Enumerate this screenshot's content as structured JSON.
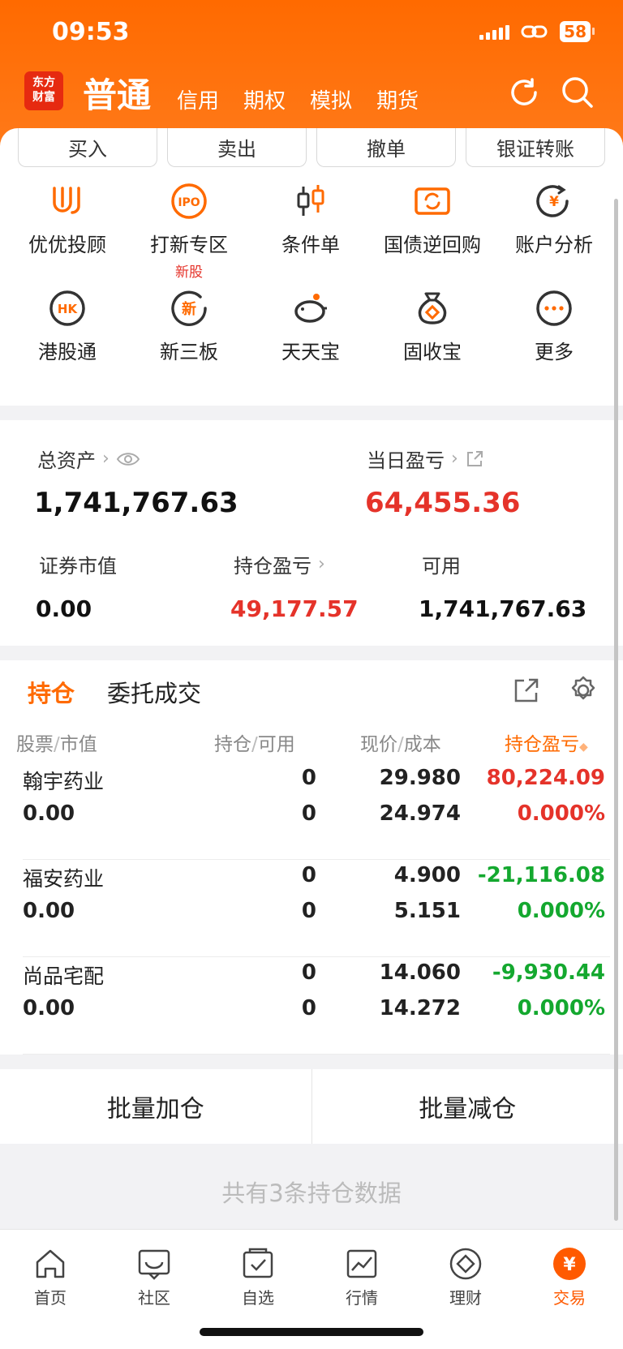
{
  "status": {
    "time": "09:53",
    "battery": "58"
  },
  "header": {
    "logo_line1": "东方",
    "logo_line2": "财富",
    "tabs": [
      "普通",
      "信用",
      "期权",
      "模拟",
      "期货"
    ]
  },
  "quick_buttons": [
    "买入",
    "卖出",
    "撤单",
    "银证转账"
  ],
  "grid": [
    {
      "label": "优优投顾",
      "icon": "uu-advisor-icon"
    },
    {
      "label": "打新专区",
      "sub": "新股",
      "icon": "ipo-icon"
    },
    {
      "label": "条件单",
      "icon": "condition-order-icon"
    },
    {
      "label": "国债逆回购",
      "icon": "bond-repo-icon"
    },
    {
      "label": "账户分析",
      "icon": "account-analysis-icon"
    },
    {
      "label": "港股通",
      "icon": "hk-connect-icon"
    },
    {
      "label": "新三板",
      "icon": "neeq-icon"
    },
    {
      "label": "天天宝",
      "icon": "piggy-bank-icon"
    },
    {
      "label": "固收宝",
      "icon": "money-bag-icon"
    },
    {
      "label": "更多",
      "icon": "more-icon"
    }
  ],
  "assets": {
    "total_label": "总资产",
    "total_value": "1,741,767.63",
    "daily_label": "当日盈亏",
    "daily_value": "64,455.36",
    "market_label": "证券市值",
    "market_value": "0.00",
    "pnl_label": "持仓盈亏",
    "pnl_value": "49,177.57",
    "avail_label": "可用",
    "avail_value": "1,741,767.63"
  },
  "positions": {
    "tabs": [
      "持仓",
      "委托成交"
    ],
    "columns": [
      "股票",
      "市值",
      "持仓",
      "可用",
      "现价",
      "成本",
      "持仓盈亏"
    ],
    "rows": [
      {
        "name": "翰宇药业",
        "market_value": "0.00",
        "holding": "0",
        "available": "0",
        "price": "29.980",
        "cost": "24.974",
        "pnl": "80,224.09",
        "pnl_pct": "0.000%",
        "pnl_color": "#e5332a",
        "pct_color": "#e5332a"
      },
      {
        "name": "福安药业",
        "market_value": "0.00",
        "holding": "0",
        "available": "0",
        "price": "4.900",
        "cost": "5.151",
        "pnl": "-21,116.08",
        "pnl_pct": "0.000%",
        "pnl_color": "#14a82f",
        "pct_color": "#14a82f"
      },
      {
        "name": "尚品宅配",
        "market_value": "0.00",
        "holding": "0",
        "available": "0",
        "price": "14.060",
        "cost": "14.272",
        "pnl": "-9,930.44",
        "pnl_pct": "0.000%",
        "pnl_color": "#14a82f",
        "pct_color": "#14a82f"
      }
    ]
  },
  "batch": {
    "add": "批量加仓",
    "reduce": "批量减仓"
  },
  "footer_note": "共有3条持仓数据",
  "tabbar": [
    {
      "label": "首页",
      "icon": "home-icon"
    },
    {
      "label": "社区",
      "icon": "community-icon"
    },
    {
      "label": "自选",
      "icon": "watchlist-icon"
    },
    {
      "label": "行情",
      "icon": "market-icon"
    },
    {
      "label": "理财",
      "icon": "wealth-icon"
    },
    {
      "label": "交易",
      "icon": "trade-icon"
    }
  ],
  "colors": {
    "accent": "#ff6a00",
    "up": "#e5332a",
    "down": "#14a82f"
  }
}
